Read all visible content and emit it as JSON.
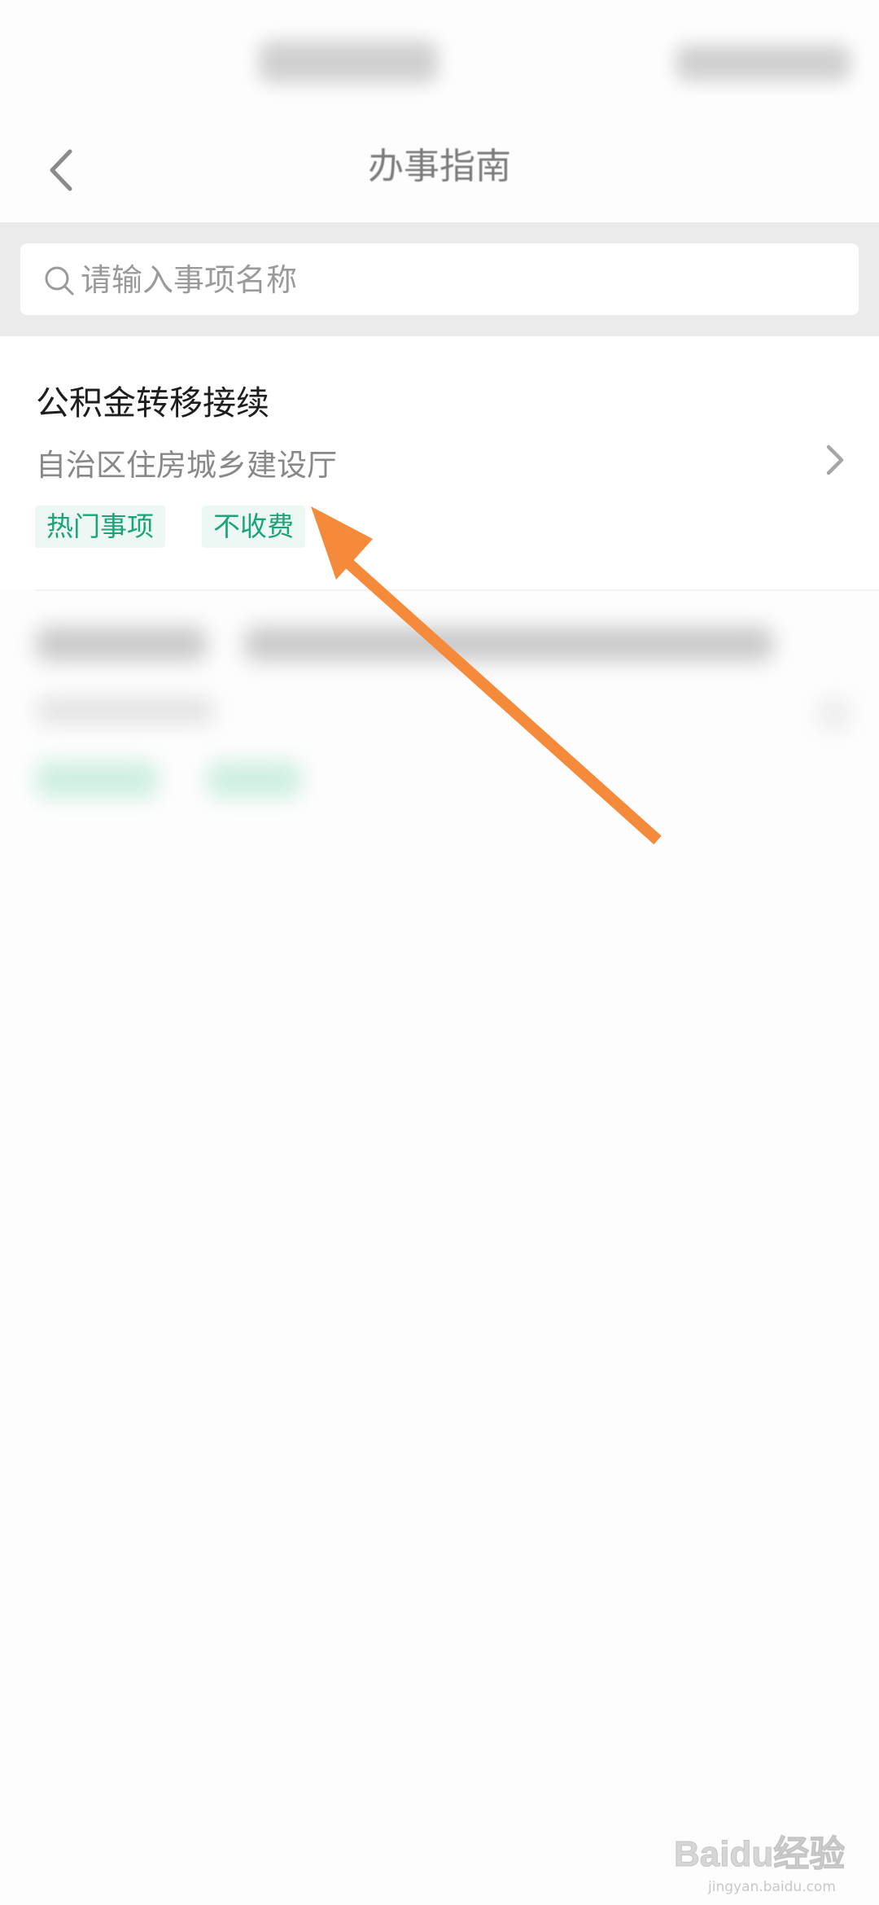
{
  "colors": {
    "tag_text": "#19a47a",
    "tag_bg": "#edf8f4",
    "annotation_arrow": "#f58a3a",
    "search_band": "#ebebeb"
  },
  "nav": {
    "title": "办事指南",
    "back_icon": "chevron-left-icon"
  },
  "search": {
    "placeholder": "请输入事项名称",
    "icon": "search-icon"
  },
  "items": [
    {
      "title": "公积金转移接续",
      "department": "自治区住房城乡建设厅",
      "tags": [
        "热门事项",
        "不收费"
      ],
      "icon": "chevron-right-icon"
    }
  ],
  "watermark": {
    "brand": "Baidu经验",
    "url": "jingyan.baidu.com"
  }
}
